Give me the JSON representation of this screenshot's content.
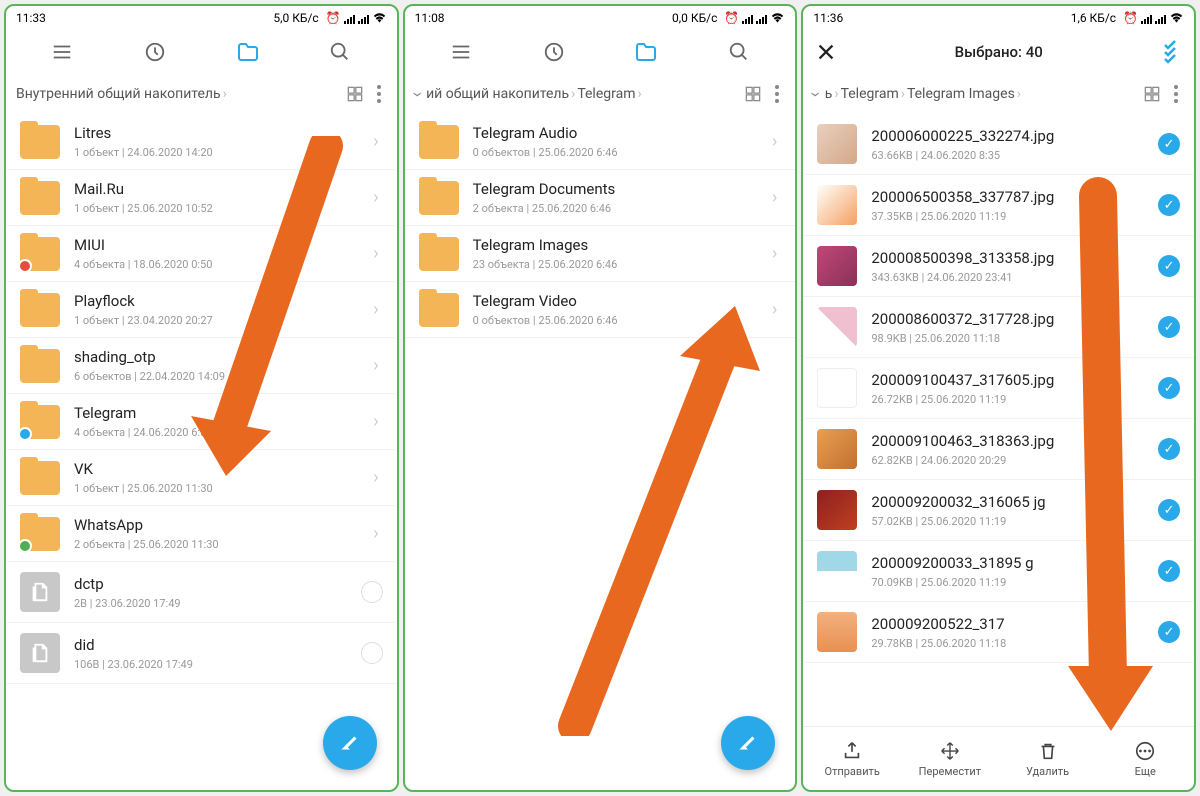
{
  "p1": {
    "time": "11:33",
    "net": "5,0 КБ/с",
    "bc": "Внутренний общий накопитель",
    "rows": [
      {
        "n": "Litres",
        "m": "1 объект  |  24.06.2020 14:20",
        "t": "f"
      },
      {
        "n": "Mail.Ru",
        "m": "1 объект  |  25.06.2020 10:52",
        "t": "f"
      },
      {
        "n": "MIUI",
        "m": "4 объекта  |  18.06.2020 0:50",
        "t": "f",
        "b": "red"
      },
      {
        "n": "Playflock",
        "m": "1 объект  |  23.04.2020 20:27",
        "t": "f"
      },
      {
        "n": "shading_otp",
        "m": "6 объектов  |  22.04.2020 14:09",
        "t": "f"
      },
      {
        "n": "Telegram",
        "m": "4 объекта  |  24.06.2020 6:50",
        "t": "f",
        "b": "blue"
      },
      {
        "n": "VK",
        "m": "1 объект  |  25.06.2020 11:30",
        "t": "f"
      },
      {
        "n": "WhatsApp",
        "m": "2 объекта  |  25.06.2020 11:30",
        "t": "f",
        "b": "grn"
      },
      {
        "n": "dctp",
        "m": "2B  |  23.06.2020 17:49",
        "t": "d"
      },
      {
        "n": "did",
        "m": "106B  |  23.06.2020 17:49",
        "t": "d"
      }
    ]
  },
  "p2": {
    "time": "11:08",
    "net": "0,0 КБ/с",
    "bc1": "ий общий накопитель",
    "bc2": "Telegram",
    "rows": [
      {
        "n": "Telegram Audio",
        "m": "0 объектов  |  25.06.2020 6:46"
      },
      {
        "n": "Telegram Documents",
        "m": "2 объекта  |  25.06.2020 6:46"
      },
      {
        "n": "Telegram Images",
        "m": "23 объекта  |  25.06.2020 6:46"
      },
      {
        "n": "Telegram Video",
        "m": "0 объектов  |  25.06.2020 6:46"
      }
    ]
  },
  "p3": {
    "time": "11:36",
    "net": "1,6 КБ/с",
    "title": "Выбрано: 40",
    "bc1": "ь",
    "bc2": "Telegram",
    "bc3": "Telegram Images",
    "rows": [
      {
        "n": "200006000225_332274.jpg",
        "m": "63.66KB  |  24.06.2020 8:35",
        "c": "t1"
      },
      {
        "n": "200006500358_337787.jpg",
        "m": "37.35KB  |  25.06.2020 11:19",
        "c": "t2"
      },
      {
        "n": "200008500398_313358.jpg",
        "m": "343.63KB  |  24.06.2020 23:41",
        "c": "t3"
      },
      {
        "n": "200008600372_317728.jpg",
        "m": "98.9KB  |  25.06.2020 11:18",
        "c": "t4"
      },
      {
        "n": "200009100437_317605.jpg",
        "m": "26.72KB  |  25.06.2020 11:19",
        "c": "t5"
      },
      {
        "n": "200009100463_318363.jpg",
        "m": "62.82KB  |  24.06.2020 20:29",
        "c": "t6"
      },
      {
        "n": "200009200032_316065  jg",
        "m": "57.02KB  |  25.06.2020 11:19",
        "c": "t7"
      },
      {
        "n": "200009200033_31895    g",
        "m": "70.09KB  |  25.06.2020 11:19",
        "c": "t8"
      },
      {
        "n": "200009200522_317",
        "m": "29.78KB  |  25.06.2020 11:18",
        "c": "t9"
      }
    ],
    "btns": {
      "send": "Отправить",
      "move": "Переместит",
      "del": "Удалить",
      "more": "Еще"
    }
  }
}
